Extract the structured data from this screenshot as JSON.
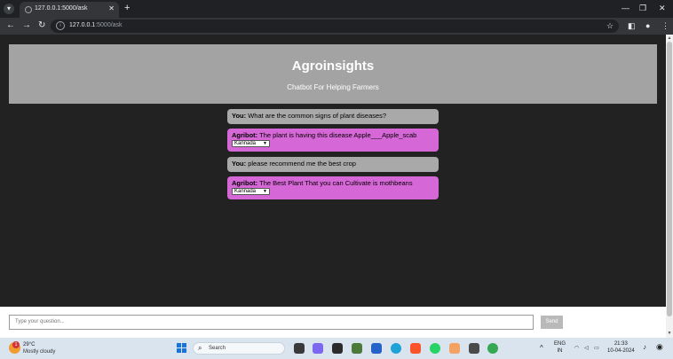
{
  "browser": {
    "tab_title": "127.0.0.1:5000/ask",
    "tab_close": "✕",
    "new_tab": "+",
    "url_host": "127.0.0.1",
    "url_path": ":5000/ask",
    "window_controls": {
      "minimize": "—",
      "restore": "❐",
      "close": "✕"
    }
  },
  "header": {
    "title": "Agroinsights",
    "subtitle": "Chatbot For Helping Farmers"
  },
  "messages": [
    {
      "speaker": "You:",
      "text": " What are the common signs of plant diseases?",
      "kind": "user"
    },
    {
      "speaker": "Agribot:",
      "text": " The plant is having this disease Apple___Apple_scab",
      "kind": "bot",
      "language": "Kannada"
    },
    {
      "speaker": "You:",
      "text": " please recommend me the best crop",
      "kind": "user"
    },
    {
      "speaker": "Agribot:",
      "text": " The Best Plant That you can Cultivate is mothbeans",
      "kind": "bot",
      "language": "Kannada"
    }
  ],
  "input": {
    "placeholder": "Type your question...",
    "send_label": "Send"
  },
  "taskbar": {
    "weather_badge": "1",
    "temperature": "29°C",
    "weather": "Mostly cloudy",
    "search_label": "Search",
    "lang_top": "ENG",
    "lang_bottom": "IN",
    "time": "21:33",
    "date": "10-04-2024"
  },
  "colors": {
    "header_bg": "#a3a3a3",
    "user_bubble": "#a9a9a9",
    "bot_bubble": "#d667d6",
    "page_bg": "#222222"
  }
}
